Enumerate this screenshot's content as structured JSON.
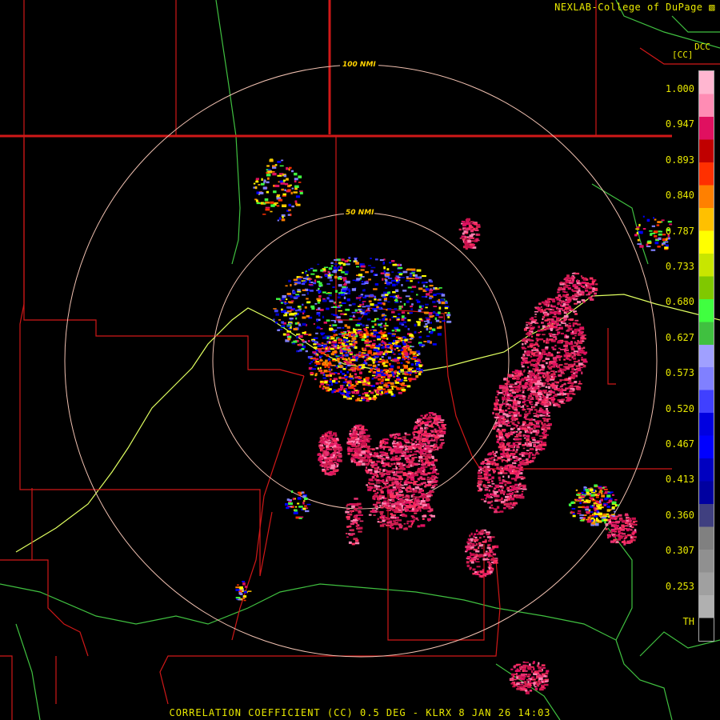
{
  "header": {
    "credit": "NEXLAB-College of DuPage",
    "site_code": "DCC",
    "unit": "[CC]"
  },
  "footer": {
    "caption": "CORRELATION COEFFICIENT (CC) 0.5 DEG - KLRX 8 JAN 26 14:03"
  },
  "rings": [
    {
      "label": "100 NMI"
    },
    {
      "label": "50 NMI"
    }
  ],
  "legend": {
    "labels": [
      "1.000",
      "0.947",
      "0.893",
      "0.840",
      "0.787",
      "0.733",
      "0.680",
      "0.627",
      "0.573",
      "0.520",
      "0.467",
      "0.413",
      "0.360",
      "0.307",
      "0.253",
      "TH"
    ],
    "colors": [
      "#ffb6d0",
      "#ff8cb4",
      "#e01060",
      "#c00000",
      "#ff3000",
      "#ff8000",
      "#ffc000",
      "#ffff00",
      "#c8e600",
      "#80c800",
      "#40ff40",
      "#40c040",
      "#a0a0ff",
      "#8080ff",
      "#4040ff",
      "#0000e0",
      "#0000ff",
      "#0000c0",
      "#0000a0",
      "#404080",
      "#808080",
      "#909090",
      "#a0a0a0",
      "#b0b0b0",
      "#000000"
    ]
  },
  "colors": {
    "borders": "#d01818",
    "rivers": "#e0ff60",
    "roads": "#40c040",
    "rings": "#f0c0b0",
    "text": "#e8e800"
  }
}
